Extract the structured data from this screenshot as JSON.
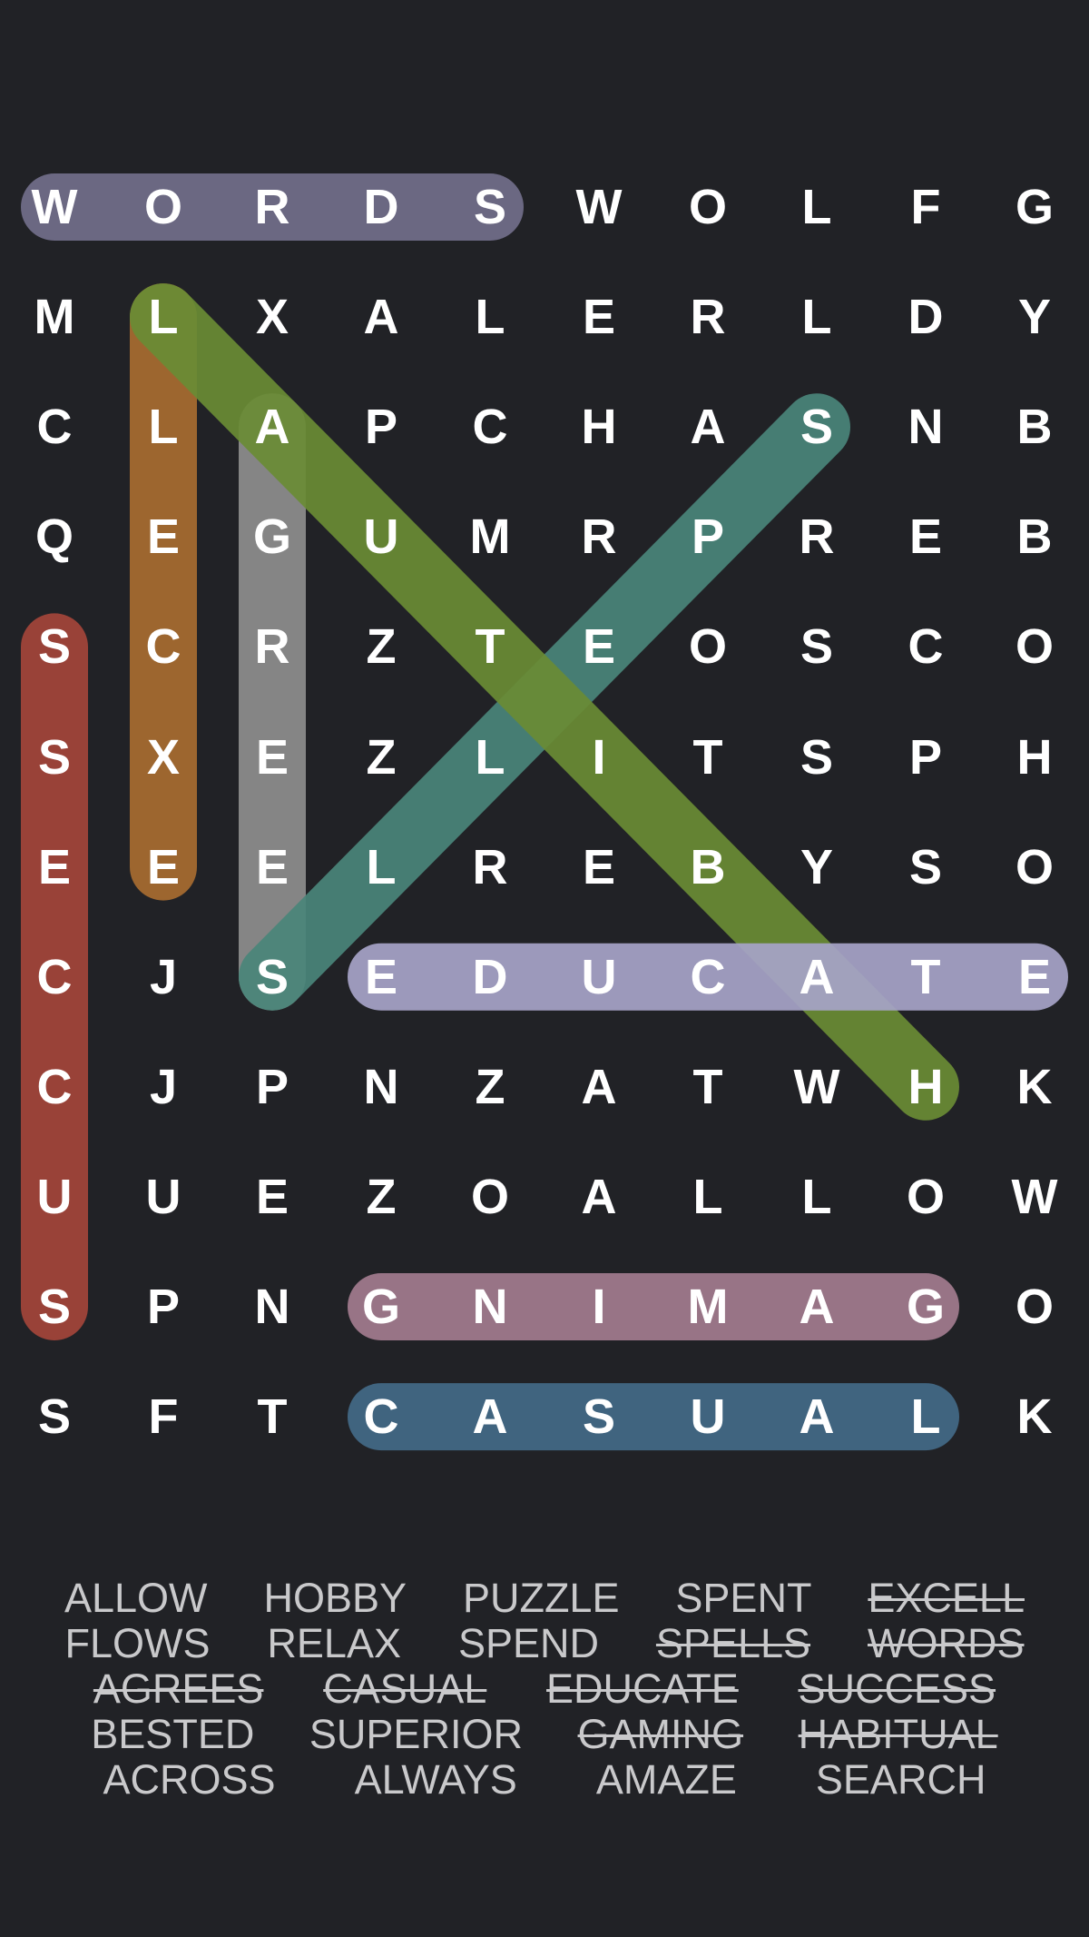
{
  "grid": {
    "rows": [
      [
        "W",
        "O",
        "R",
        "D",
        "S",
        "W",
        "O",
        "L",
        "F",
        "G"
      ],
      [
        "M",
        "L",
        "X",
        "A",
        "L",
        "E",
        "R",
        "L",
        "D",
        "Y"
      ],
      [
        "C",
        "L",
        "A",
        "P",
        "C",
        "H",
        "A",
        "S",
        "N",
        "B"
      ],
      [
        "Q",
        "E",
        "G",
        "U",
        "M",
        "R",
        "P",
        "R",
        "E",
        "B"
      ],
      [
        "S",
        "C",
        "R",
        "Z",
        "T",
        "E",
        "O",
        "S",
        "C",
        "O"
      ],
      [
        "S",
        "X",
        "E",
        "Z",
        "L",
        "I",
        "T",
        "S",
        "P",
        "H"
      ],
      [
        "E",
        "E",
        "E",
        "L",
        "R",
        "E",
        "B",
        "Y",
        "S",
        "O"
      ],
      [
        "C",
        "J",
        "S",
        "E",
        "D",
        "U",
        "C",
        "A",
        "T",
        "E"
      ],
      [
        "C",
        "J",
        "P",
        "N",
        "Z",
        "A",
        "T",
        "W",
        "H",
        "K"
      ],
      [
        "U",
        "U",
        "E",
        "Z",
        "O",
        "A",
        "L",
        "L",
        "O",
        "W"
      ],
      [
        "S",
        "P",
        "N",
        "G",
        "N",
        "I",
        "M",
        "A",
        "G",
        "O"
      ],
      [
        "S",
        "F",
        "T",
        "C",
        "A",
        "S",
        "U",
        "A",
        "L",
        "K"
      ]
    ]
  },
  "found_words": [
    {
      "word": "WORDS",
      "start": [
        0,
        0
      ],
      "end": [
        0,
        4
      ],
      "color": "#726e8a"
    },
    {
      "word": "SUCCESS",
      "start": [
        10,
        0
      ],
      "end": [
        4,
        0
      ],
      "color": "#a4453a"
    },
    {
      "word": "EXCELL",
      "start": [
        6,
        1
      ],
      "end": [
        1,
        1
      ],
      "color": "#a86c30"
    },
    {
      "word": "AGREES",
      "start": [
        2,
        2
      ],
      "end": [
        7,
        2
      ],
      "color": "#8e8e8e"
    },
    {
      "word": "SPELLS",
      "start": [
        2,
        7
      ],
      "end": [
        7,
        2
      ],
      "color": "#4a857a"
    },
    {
      "word": "HABITUAL",
      "start": [
        8,
        8
      ],
      "end": [
        1,
        1
      ],
      "color": "#6a8c35"
    },
    {
      "word": "EDUCATE",
      "start": [
        7,
        3
      ],
      "end": [
        7,
        9
      ],
      "color": "#a7a4c8"
    },
    {
      "word": "GAMING",
      "start": [
        10,
        8
      ],
      "end": [
        10,
        3
      ],
      "color": "#a37c8f"
    },
    {
      "word": "CASUAL",
      "start": [
        11,
        3
      ],
      "end": [
        11,
        8
      ],
      "color": "#436a87"
    }
  ],
  "word_list": {
    "rows": [
      [
        {
          "text": "ALLOW",
          "found": false
        },
        {
          "text": "HOBBY",
          "found": false
        },
        {
          "text": "PUZZLE",
          "found": false
        },
        {
          "text": "SPENT",
          "found": false
        },
        {
          "text": "EXCELL",
          "found": true
        }
      ],
      [
        {
          "text": "FLOWS",
          "found": false
        },
        {
          "text": "RELAX",
          "found": false
        },
        {
          "text": "SPEND",
          "found": false
        },
        {
          "text": "SPELLS",
          "found": true
        },
        {
          "text": "WORDS",
          "found": true
        }
      ],
      [
        {
          "text": "AGREES",
          "found": true
        },
        {
          "text": "CASUAL",
          "found": true
        },
        {
          "text": "EDUCATE",
          "found": true
        },
        {
          "text": "SUCCESS",
          "found": true
        }
      ],
      [
        {
          "text": "BESTED",
          "found": false
        },
        {
          "text": "SUPERIOR",
          "found": false
        },
        {
          "text": "GAMING",
          "found": true
        },
        {
          "text": "HABITUAL",
          "found": true
        }
      ],
      [
        {
          "text": "ACROSS",
          "found": false
        },
        {
          "text": "ALWAYS",
          "found": false
        },
        {
          "text": "AMAZE",
          "found": false
        },
        {
          "text": "SEARCH",
          "found": false
        }
      ]
    ]
  },
  "colors": {
    "background": "#212226",
    "letter": "#ffffff",
    "word_list_text": "#c9c9cb"
  }
}
